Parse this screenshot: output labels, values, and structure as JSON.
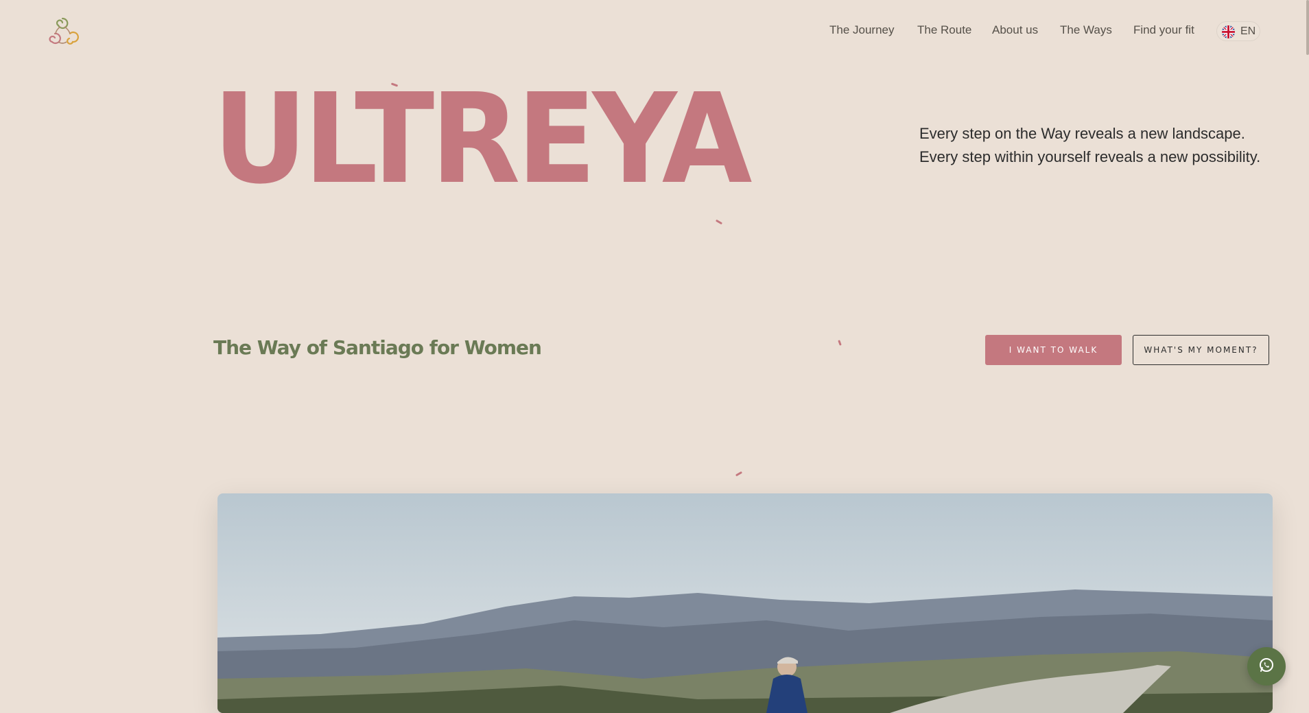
{
  "header": {
    "logo_icon": "triskelion-logo-icon",
    "nav": [
      "The Journey",
      "The Route",
      "About us",
      "The Ways",
      "Find your fit"
    ],
    "language": {
      "code": "EN",
      "flag_icon": "uk-flag-icon"
    }
  },
  "hero": {
    "title": "ULTREYA",
    "tagline": [
      "Every step on the Way reveals a new landscape.",
      "Every step within yourself reveals a new possibility."
    ],
    "subtitle": "The Way of Santiago for Women",
    "buttons": {
      "primary": "I WANT TO WALK",
      "secondary": "WHAT'S MY MOMENT?"
    }
  },
  "floating": {
    "whatsapp_icon": "whatsapp-icon"
  },
  "colors": {
    "background": "#ebe0d6",
    "accent": "#c4787f",
    "green": "#6a7a55",
    "whatsapp": "#5b7446"
  }
}
